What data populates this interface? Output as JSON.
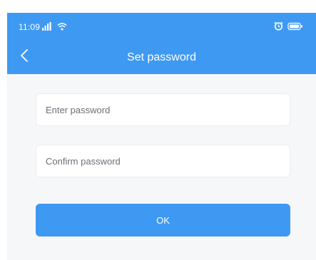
{
  "status_bar": {
    "time": "11:09",
    "icons": [
      "signal-icon",
      "wifi-icon",
      "alarm-icon",
      "battery-icon"
    ]
  },
  "navbar": {
    "title": "Set password",
    "back_icon": "chevron-left-icon"
  },
  "form": {
    "password_placeholder": "Enter password",
    "confirm_placeholder": "Confirm password",
    "ok_label": "OK"
  },
  "colors": {
    "primary": "#3e99f2",
    "background": "#f6f7f9",
    "input_border": "#ebedf0",
    "placeholder": "#6b6f75"
  }
}
